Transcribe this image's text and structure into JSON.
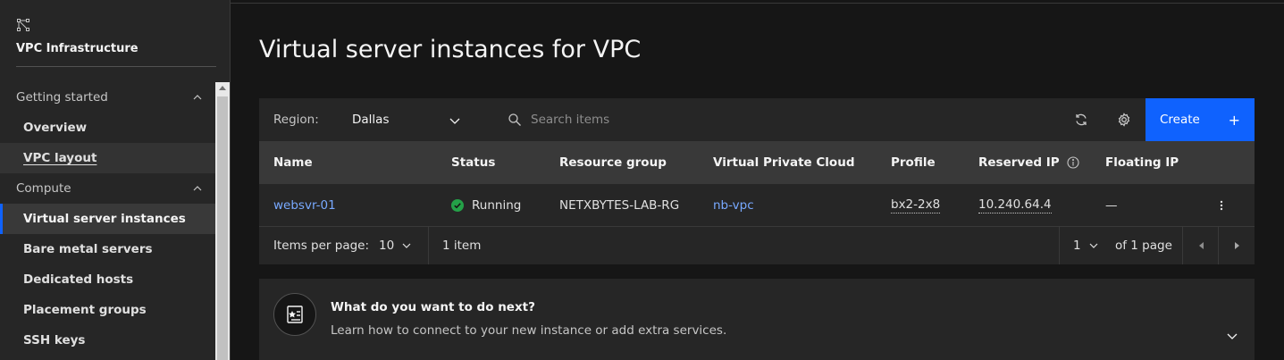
{
  "sidebar": {
    "title": "VPC Infrastructure",
    "sections": [
      {
        "label": "Getting started",
        "items": [
          {
            "label": "Overview"
          },
          {
            "label": "VPC layout"
          }
        ]
      },
      {
        "label": "Compute",
        "items": [
          {
            "label": "Virtual server instances"
          },
          {
            "label": "Bare metal servers"
          },
          {
            "label": "Dedicated hosts"
          },
          {
            "label": "Placement groups"
          },
          {
            "label": "SSH keys"
          }
        ]
      }
    ]
  },
  "main": {
    "title": "Virtual server instances for VPC",
    "toolbar": {
      "region_label": "Region:",
      "region_value": "Dallas",
      "search_placeholder": "Search items",
      "create_label": "Create",
      "create_icon": "+"
    },
    "table": {
      "columns": [
        "Name",
        "Status",
        "Resource group",
        "Virtual Private Cloud",
        "Profile",
        "Reserved IP",
        "Floating IP"
      ],
      "rows": [
        {
          "name": "websvr-01",
          "status": "Running",
          "resource_group": "NETXBYTES-LAB-RG",
          "vpc": "nb-vpc",
          "profile": "bx2-2x8",
          "reserved_ip": "10.240.64.4",
          "floating_ip": "—"
        }
      ],
      "status_color": "#24a148"
    },
    "pagination": {
      "items_per_page_label": "Items per page:",
      "items_per_page": "10",
      "item_count": "1 item",
      "page": "1",
      "of_pages": "of 1 page"
    },
    "next_card": {
      "title": "What do you want to do next?",
      "description": "Learn how to connect to your new instance or add extra services."
    }
  },
  "colors": {
    "accent": "#0f62fe",
    "link": "#78a9ff",
    "success": "#24a148"
  }
}
